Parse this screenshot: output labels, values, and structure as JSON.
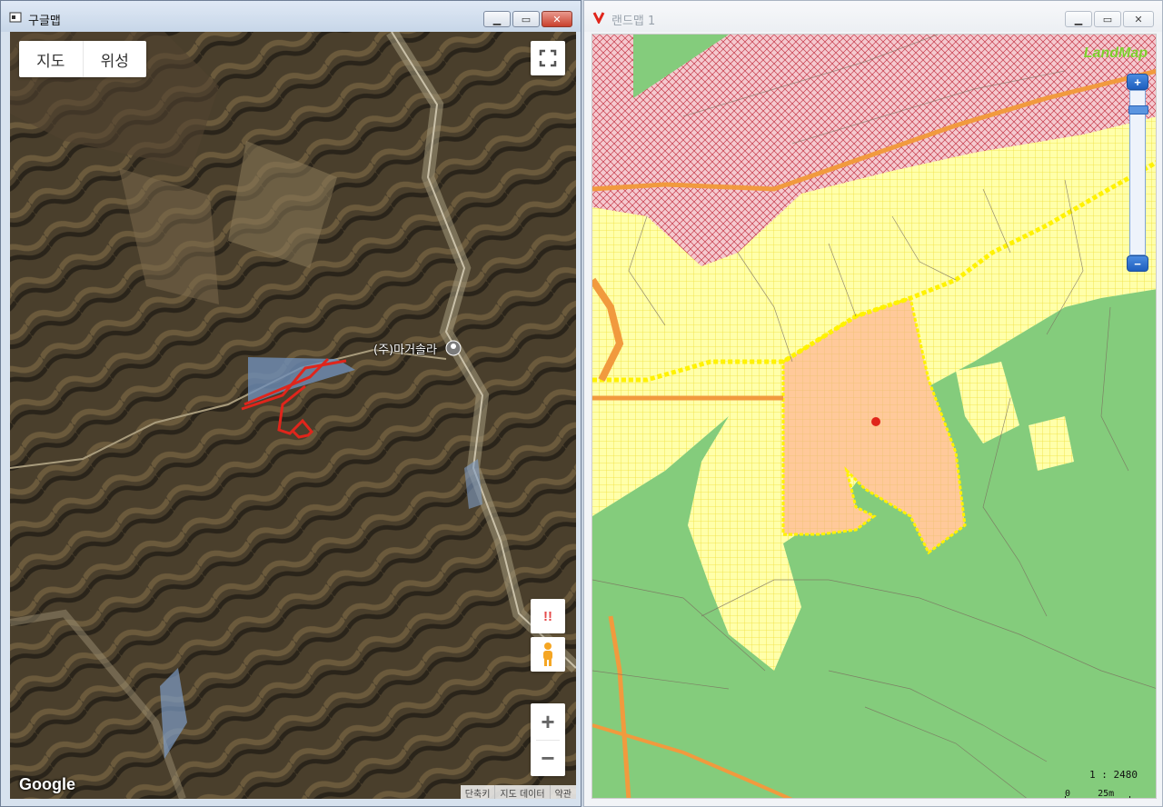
{
  "left_window": {
    "title": "구글맵",
    "map_type_buttons": [
      {
        "label": "지도",
        "selected": false
      },
      {
        "label": "위성",
        "selected": true
      }
    ],
    "place_label": "(주)마거솔라",
    "logo_text": "Google",
    "footer_links": [
      "단축키",
      "지도 데이터",
      "약관"
    ],
    "alert_symbol": "!!",
    "zoom_in_symbol": "+",
    "zoom_out_symbol": "−",
    "window_buttons": [
      "minimize",
      "maximize",
      "close"
    ]
  },
  "right_window": {
    "title": "랜드맵 1",
    "logo_text": "LandMap",
    "zoom_in_symbol": "+",
    "zoom_out_symbol": "−",
    "scale_ratio": "1 : 2480",
    "scale_bar_start": "0",
    "scale_bar_label": "25m",
    "window_buttons": [
      "minimize",
      "maximize",
      "close"
    ]
  },
  "colors": {
    "parcel_outline": "#e0251b",
    "lm_forest": "#84cc7c",
    "lm_field": "#ffffaa",
    "lm_restricted": "#f2b8c0",
    "lm_selected_parcel": "#ffc99a",
    "lm_road": "#f19a3e",
    "lm_boundary": "#fff200"
  }
}
